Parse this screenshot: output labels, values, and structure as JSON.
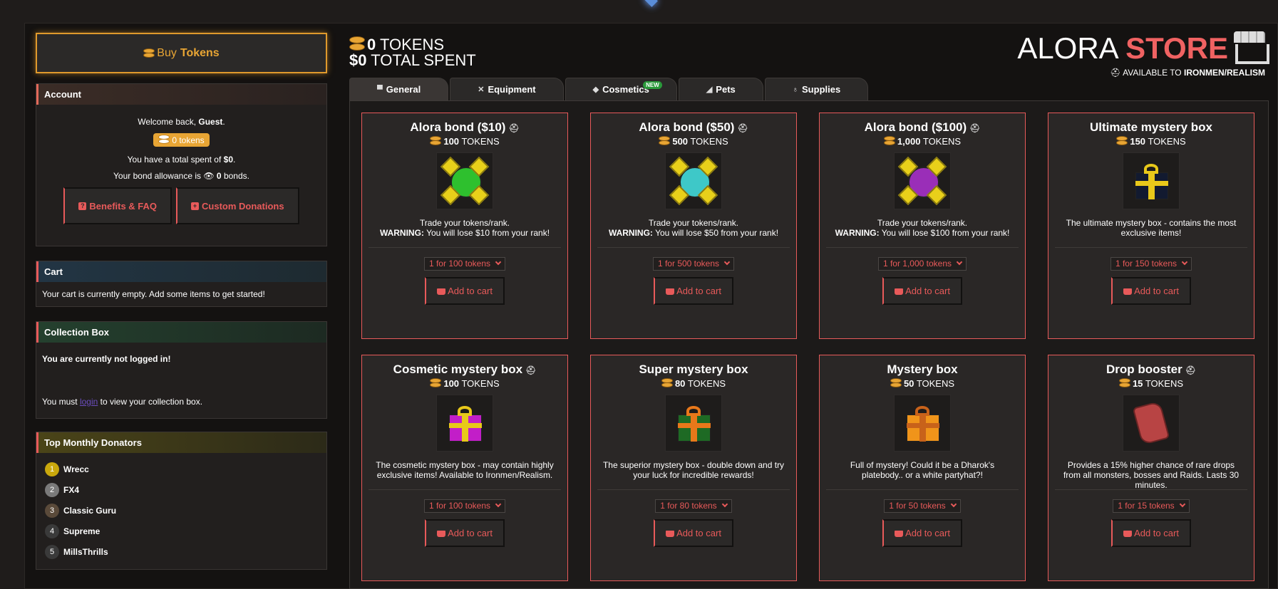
{
  "sidebar": {
    "buy_prefix": "Buy",
    "buy_bold": "Tokens",
    "account": {
      "title": "Account",
      "welcome_prefix": "Welcome back,",
      "welcome_name": "Guest",
      "welcome_suffix": ".",
      "tokens_badge": "0 tokens",
      "spent_prefix": "You have a total spent of",
      "spent_value": "$0",
      "spent_suffix": ".",
      "bond_prefix": "Your bond allowance is",
      "bond_value": "0",
      "bond_suffix": "bonds.",
      "benefits_label": "Benefits & FAQ",
      "custom_label": "Custom Donations"
    },
    "cart": {
      "title": "Cart",
      "empty_text": "Your cart is currently empty. Add some items to get started!"
    },
    "collection": {
      "title": "Collection Box",
      "not_logged": "You are currently not logged in!",
      "must_prefix": "You must",
      "login_link": "login",
      "must_suffix": "to view your collection box."
    },
    "donators": {
      "title": "Top Monthly Donators",
      "list": [
        {
          "rank": "1",
          "name": "Wrecc",
          "color": "#c9a80c"
        },
        {
          "rank": "2",
          "name": "FX4",
          "color": "#7a7a7a"
        },
        {
          "rank": "3",
          "name": "Classic Guru",
          "color": "#5a4a3a"
        },
        {
          "rank": "4",
          "name": "Supreme",
          "color": "#3a3a3a"
        },
        {
          "rank": "5",
          "name": "MillsThrills",
          "color": "#3a3a3a"
        }
      ]
    }
  },
  "header": {
    "tokens_value": "0",
    "tokens_label": "TOKENS",
    "spent_value": "$0",
    "spent_label": "TOTAL SPENT",
    "store_word1": "ALORA",
    "store_word2": "STORE",
    "avail_prefix": "AVAILABLE TO",
    "avail_bold": "IRONMEN/REALISM"
  },
  "tabs": [
    {
      "label": "General",
      "icon": "store-icon",
      "active": true
    },
    {
      "label": "Equipment",
      "icon": "swords-icon"
    },
    {
      "label": "Cosmetics",
      "icon": "diamond-icon",
      "badge": "NEW"
    },
    {
      "label": "Pets",
      "icon": "pet-icon"
    },
    {
      "label": "Supplies",
      "icon": "potion-icon"
    }
  ],
  "items": [
    {
      "title": "Alora bond ($10)",
      "helm": true,
      "price": "100",
      "unit": "TOKENS",
      "desc_plain": "Trade your tokens/rank.",
      "desc_warn": "WARNING:",
      "desc_rest": "You will lose $10 from your rank!",
      "select": "1 for 100 tokens",
      "button": "Add to cart",
      "img": "bond",
      "gem": "#2ec02e"
    },
    {
      "title": "Alora bond ($50)",
      "helm": true,
      "price": "500",
      "unit": "TOKENS",
      "desc_plain": "Trade your tokens/rank.",
      "desc_warn": "WARNING:",
      "desc_rest": "You will lose $50 from your rank!",
      "select": "1 for 500 tokens",
      "button": "Add to cart",
      "img": "bond",
      "gem": "#3ec8c8"
    },
    {
      "title": "Alora bond ($100)",
      "helm": true,
      "price": "1,000",
      "unit": "TOKENS",
      "desc_plain": "Trade your tokens/rank.",
      "desc_warn": "WARNING:",
      "desc_rest": "You will lose $100 from your rank!",
      "select": "1 for 1,000 tokens",
      "button": "Add to cart",
      "img": "bond",
      "gem": "#9a2eb8"
    },
    {
      "title": "Ultimate mystery box",
      "helm": false,
      "price": "150",
      "unit": "TOKENS",
      "desc_plain": "The ultimate mystery box - contains the most exclusive items!",
      "desc_warn": "",
      "desc_rest": "",
      "select": "1 for 150 tokens",
      "button": "Add to cart",
      "img": "gift",
      "box": "#121a30",
      "ribbon": "#e8c81a"
    },
    {
      "title": "Cosmetic mystery box",
      "helm": true,
      "price": "100",
      "unit": "TOKENS",
      "desc_plain": "The cosmetic mystery box - may contain highly exclusive items! Available to Ironmen/Realism.",
      "desc_warn": "",
      "desc_rest": "",
      "select": "1 for 100 tokens",
      "button": "Add to cart",
      "img": "gift",
      "box": "#c21ec8",
      "ribbon": "#e8c81a"
    },
    {
      "title": "Super mystery box",
      "helm": false,
      "price": "80",
      "unit": "TOKENS",
      "desc_plain": "The superior mystery box - double down and try your luck for incredible rewards!",
      "desc_warn": "",
      "desc_rest": "",
      "select": "1 for 80 tokens",
      "button": "Add to cart",
      "img": "gift",
      "box": "#1e6a24",
      "ribbon": "#e8781a"
    },
    {
      "title": "Mystery box",
      "helm": false,
      "price": "50",
      "unit": "TOKENS",
      "desc_plain": "Full of mystery! Could it be a Dharok's platebody.. or a white partyhat?!",
      "desc_warn": "",
      "desc_rest": "",
      "select": "1 for 50 tokens",
      "button": "Add to cart",
      "img": "gift",
      "box": "#f0941a",
      "ribbon": "#c8621a"
    },
    {
      "title": "Drop booster",
      "helm": true,
      "price": "15",
      "unit": "TOKENS",
      "desc_plain": "Provides a 15% higher chance of rare drops from all monsters, bosses and Raids. Lasts 30 minutes.",
      "desc_warn": "",
      "desc_rest": "",
      "select": "1 for 15 tokens",
      "button": "Add to cart",
      "img": "scroll"
    }
  ],
  "colors": {
    "accent": "#e85a5a",
    "gold": "#e8a534"
  }
}
